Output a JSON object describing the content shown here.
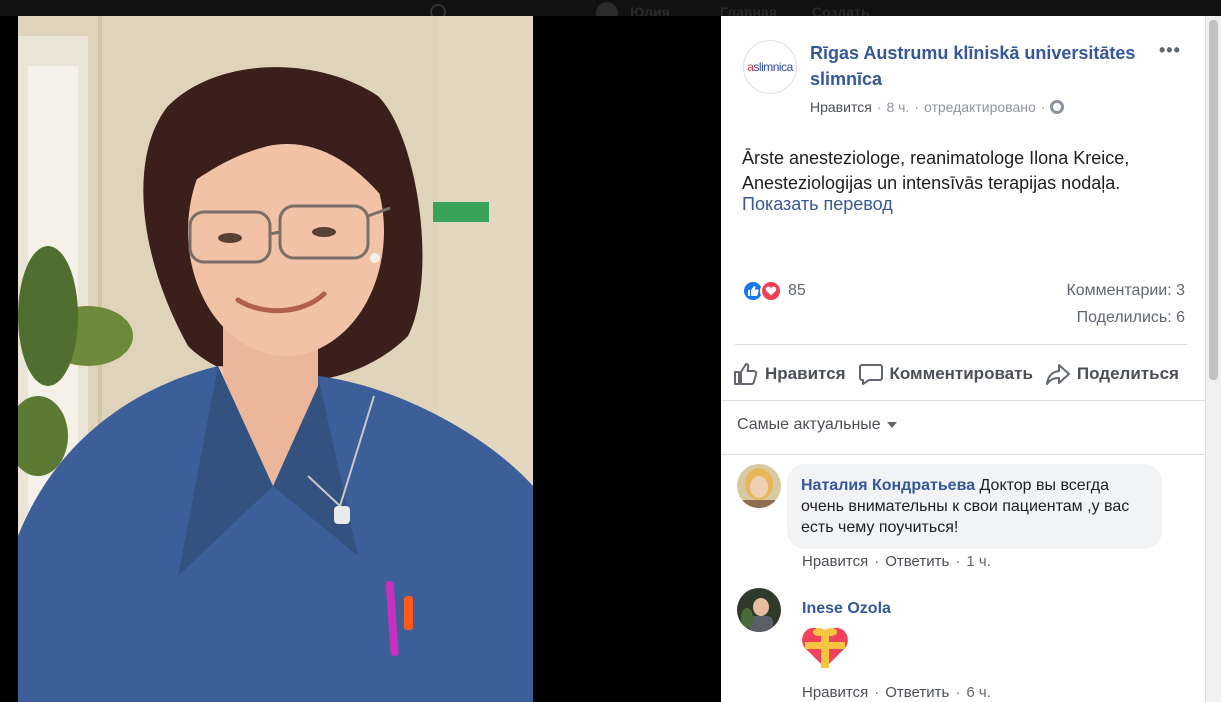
{
  "topbar": {
    "user_name": "Юлия",
    "home": "Главная",
    "create": "Создать"
  },
  "post": {
    "page_name": "Rīgas Austrumu klīniskā universitātes slimnīca",
    "page_logo_text_a": "a",
    "page_logo_text_b": "slimnica",
    "meta_like": "Нравится",
    "meta_time": "8 ч.",
    "meta_edited": "отредактировано",
    "text_line1": "Ārste anesteziologe, reanimatologe Ilona Kreice,",
    "text_line2": "Anesteziologijas un intensīvās terapijas nodaļa.",
    "translate": "Показать перевод",
    "reaction_count": "85",
    "comments_count": "Комментарии: 3",
    "shares_count": "Поделились: 6"
  },
  "actions": {
    "like": "Нравится",
    "comment": "Комментировать",
    "share": "Поделиться"
  },
  "sort": {
    "label": "Самые актуальные"
  },
  "comments": [
    {
      "author": "Наталия Кондратьева",
      "text": " Доктор вы всегда очень внимательны к свои пациентам ,у вас есть чему поучиться!",
      "like": "Нравится",
      "reply": "Ответить",
      "time": "1 ч."
    },
    {
      "author": "Inese Ozola",
      "like": "Нравится",
      "reply": "Ответить",
      "time": "6 ч."
    }
  ],
  "colors": {
    "link": "#365899",
    "like_blue": "#1877f2",
    "love_red": "#f33e58",
    "scrub_blue": "#3c5f9a"
  }
}
